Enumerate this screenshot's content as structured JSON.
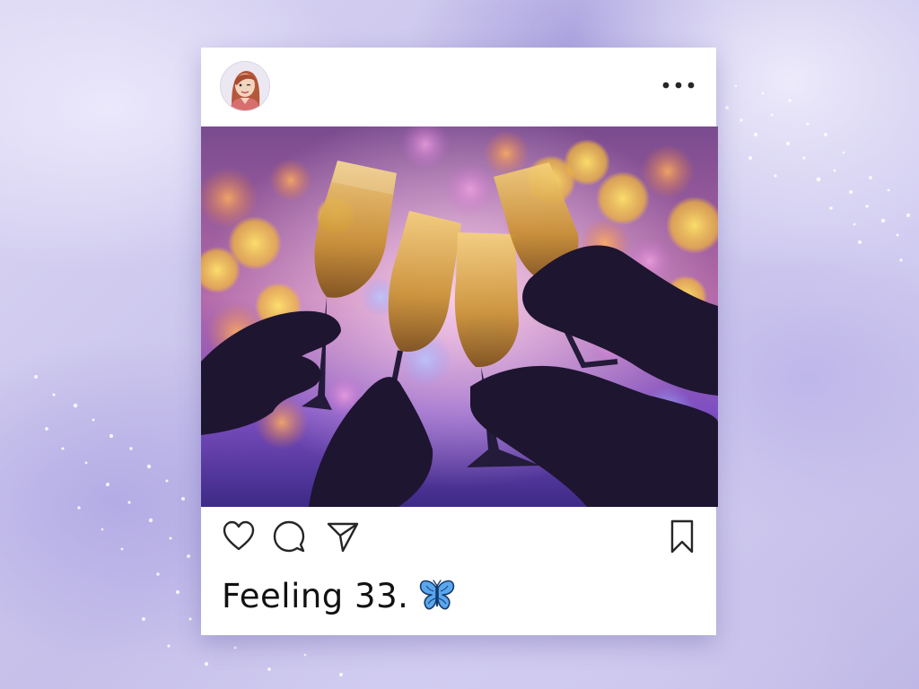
{
  "post": {
    "avatar_icon": "avatar-woman-illustration",
    "more_icon": "more-dots-icon",
    "photo_description_icon": "champagne-toast-photo",
    "actions": {
      "like_icon": "heart-icon",
      "comment_icon": "comment-bubble-icon",
      "share_icon": "paper-plane-icon",
      "save_icon": "bookmark-icon"
    },
    "caption": "Feeling 33.",
    "caption_emoji_icon": "butterfly-icon"
  },
  "colors": {
    "background": "#cbc6ec",
    "card": "#ffffff",
    "text": "#111111",
    "butterfly": "#4a90e2"
  }
}
